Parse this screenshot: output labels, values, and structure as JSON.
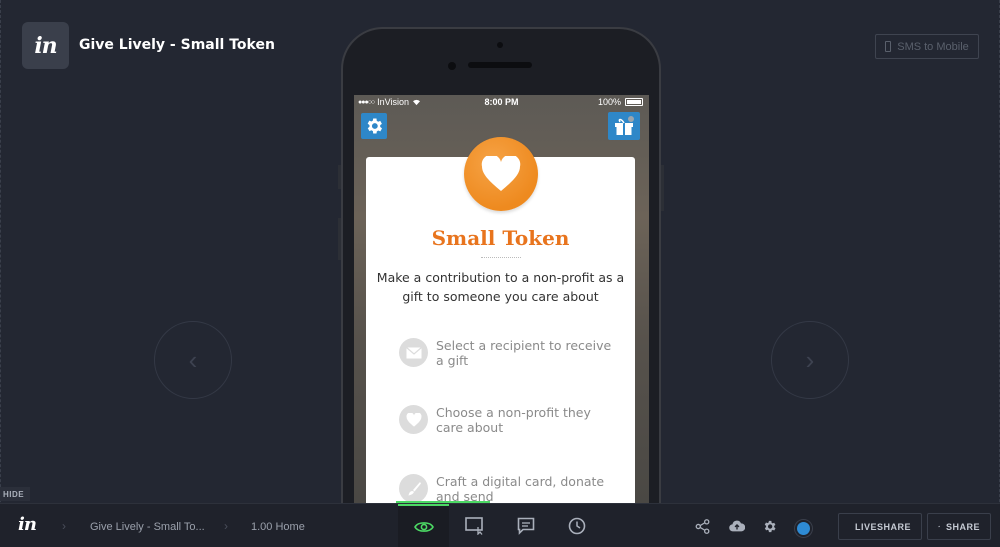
{
  "header": {
    "logo_text": "in",
    "title": "Give Lively - Small Token",
    "sms_button": "SMS to Mobile"
  },
  "nav": {
    "prev_glyph": "‹",
    "next_glyph": "›"
  },
  "phone": {
    "statusbar": {
      "carrier": "InVision",
      "time": "8:00 PM",
      "battery": "100%"
    },
    "card": {
      "title": "Small Token",
      "description": "Make a contribution to a non-profit as a gift to someone you care about",
      "steps": [
        {
          "icon": "envelope-icon",
          "text": "Select a recipient to receive a gift"
        },
        {
          "icon": "heart-icon",
          "text": "Choose a non-profit they care about"
        },
        {
          "icon": "brush-icon",
          "text": "Craft a digital card, donate and send"
        }
      ]
    },
    "colors": {
      "accent_orange": "#ee8a1f",
      "icon_blue": "#2e87c8"
    }
  },
  "hide_label": "HIDE",
  "bottombar": {
    "logo_text": "in",
    "breadcrumb_project": "Give Lively - Small To...",
    "breadcrumb_screen": "1.00 Home",
    "tools": [
      {
        "name": "preview-mode",
        "icon": "eye-icon",
        "active": true
      },
      {
        "name": "build-mode",
        "icon": "screen-cursor-icon",
        "active": false
      },
      {
        "name": "comment-mode",
        "icon": "comment-icon",
        "active": false
      },
      {
        "name": "history-mode",
        "icon": "clock-icon",
        "active": false
      }
    ],
    "liveshare": "LIVESHARE",
    "share": "SHARE",
    "active_color": "#4cd964"
  }
}
